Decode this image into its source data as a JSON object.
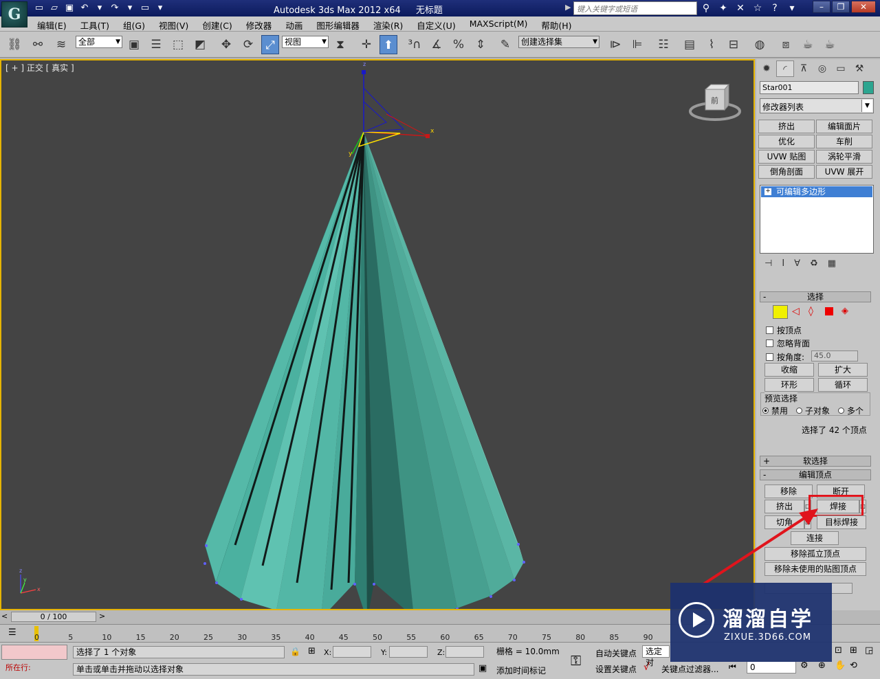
{
  "titlebar": {
    "app_title": "Autodesk 3ds Max  2012 x64",
    "doc_title": "无标题",
    "search_placeholder": "键入关键字或短语"
  },
  "menu": [
    "编辑(E)",
    "工具(T)",
    "组(G)",
    "视图(V)",
    "创建(C)",
    "修改器",
    "动画",
    "图形编辑器",
    "渲染(R)",
    "自定义(U)",
    "MAXScript(M)",
    "帮助(H)"
  ],
  "toolbar": {
    "selection_filter": "全部",
    "ref_coord": "视图",
    "named_selection": "创建选择集"
  },
  "viewport": {
    "label": "[ + ] 正交 [ 真实 ]",
    "viewcube_face": "前",
    "object_color": "#3fae9c",
    "accent_border": "#e6b400"
  },
  "command_panel": {
    "object_name": "Star001",
    "object_color": "#2ca590",
    "modifier_list": "修改器列表",
    "modifier_buttons": [
      "挤出",
      "编辑面片",
      "优化",
      "车削",
      "UVW 贴图",
      "涡轮平滑",
      "倒角剖面",
      "UVW 展开"
    ],
    "stack_item": "可编辑多边形",
    "selection": {
      "title": "选择",
      "by_vertex": "按顶点",
      "ignore_backface": "忽略背面",
      "by_angle": "按角度:",
      "angle_value": "45.0",
      "shrink": "收缩",
      "grow": "扩大",
      "ring": "环形",
      "loop": "循环",
      "preview_group": "预览选择",
      "preview_options": [
        "禁用",
        "子对象",
        "多个"
      ],
      "status": "选择了 42 个顶点"
    },
    "soft_selection": "软选择",
    "edit_vertices": {
      "title": "编辑顶点",
      "remove": "移除",
      "break": "断开",
      "extrude": "挤出",
      "weld": "焊接",
      "chamfer": "切角",
      "target_weld": "目标焊接",
      "connect": "连接",
      "remove_isolated": "移除孤立顶点",
      "remove_unused_map": "移除未使用的贴图顶点"
    }
  },
  "timeline": {
    "slider": "0 / 100",
    "ticks": [
      "0",
      "5",
      "10",
      "15",
      "20",
      "25",
      "30",
      "35",
      "40",
      "45",
      "50",
      "55",
      "60",
      "65",
      "70",
      "75",
      "80",
      "85",
      "90"
    ]
  },
  "status": {
    "selected_text": "选择了 1 个对象",
    "prompt": "单击或单击并拖动以选择对象",
    "maxscript_label": "所在行:",
    "x_label": "X:",
    "y_label": "Y:",
    "z_label": "Z:",
    "grid": "栅格 = 10.0mm",
    "add_time_tag": "添加时间标记",
    "auto_key": "自动关键点",
    "selected_obj": "选定对",
    "set_key": "设置关键点",
    "key_filters": "关键点过滤器...",
    "frame": "0"
  },
  "watermark": {
    "brand": "溜溜自学",
    "url": "ZIXUE.3D66.COM"
  }
}
